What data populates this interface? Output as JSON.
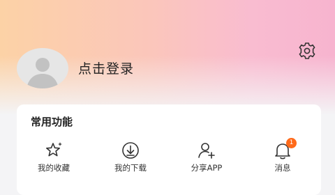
{
  "header": {
    "login_label": "点击登录"
  },
  "functions": {
    "title": "常用功能",
    "items": [
      {
        "label": "我的收藏",
        "icon": "star-sparkle-icon"
      },
      {
        "label": "我的下载",
        "icon": "download-icon"
      },
      {
        "label": "分享APP",
        "icon": "share-user-icon"
      },
      {
        "label": "消息",
        "icon": "bell-icon",
        "badge": "1"
      }
    ]
  },
  "colors": {
    "gradient_left": "#fcd2a6",
    "gradient_right": "#f7b4cf",
    "badge": "#ff6a1a"
  }
}
